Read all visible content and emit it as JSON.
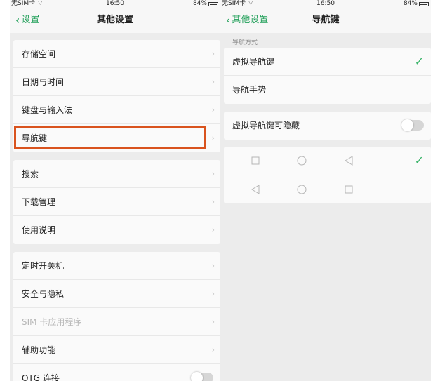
{
  "left": {
    "status": {
      "carrier": "无SIM卡",
      "time": "16:50",
      "battery": "84%"
    },
    "nav": {
      "back_label": "设置",
      "title": "其他设置"
    },
    "groups": [
      [
        "存储空间",
        "日期与时间",
        "键盘与输入法",
        "导航键"
      ],
      [
        "搜索",
        "下载管理",
        "使用说明"
      ],
      [
        "定时开关机",
        "安全与隐私",
        "SIM 卡应用程序",
        "辅助功能",
        "OTG 连接"
      ]
    ]
  },
  "right": {
    "status": {
      "carrier": "无SIM卡",
      "time": "16:50",
      "battery": "84%"
    },
    "nav": {
      "back_label": "其他设置",
      "title": "导航键"
    },
    "section_label": "导航方式",
    "options": [
      "虚拟导航键",
      "导航手势"
    ],
    "hide_toggle_label": "虚拟导航键可隐藏",
    "hide_toggle_on": false,
    "layouts": [
      {
        "icons": [
          "square-icon",
          "circle-icon",
          "triangle-left-icon"
        ],
        "selected": true
      },
      {
        "icons": [
          "triangle-left-icon",
          "circle-icon",
          "square-icon"
        ],
        "selected": false
      }
    ],
    "colors": {
      "accent": "#22a05a",
      "highlight": "#d9531e"
    }
  }
}
